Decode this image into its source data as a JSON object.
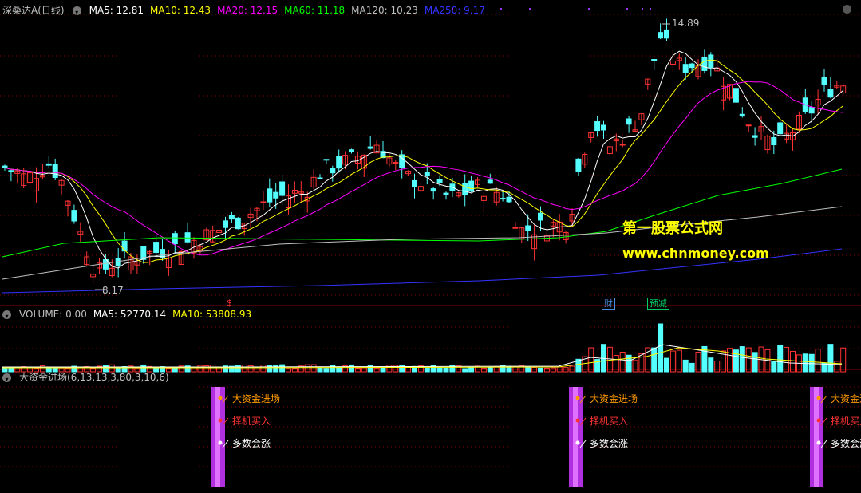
{
  "price_panel": {
    "stock_name": "深桑达A",
    "period": "(日线)",
    "ma_labels": [
      {
        "text": "MA5: 12.81",
        "color": "#ffffff"
      },
      {
        "text": "MA10: 12.43",
        "color": "#ffff00"
      },
      {
        "text": "MA20: 12.15",
        "color": "#ff00ff"
      },
      {
        "text": "MA60: 11.18",
        "color": "#00ff00"
      },
      {
        "text": "MA120: 10.23",
        "color": "#c0c0c0"
      },
      {
        "text": "MA250: 9.17",
        "color": "#3333ff"
      }
    ],
    "high_label": "14.89",
    "low_label": "8.17",
    "badges": [
      {
        "text": "$",
        "color": "#ff3333"
      },
      {
        "text": "财",
        "color": "#4a90e2"
      },
      {
        "text": "预减",
        "color": "#00cc66"
      }
    ],
    "icon": "gear-circle-icon"
  },
  "volume_panel": {
    "labels": [
      {
        "text": "VOLUME: 0.00",
        "color": "#c0c0c0"
      },
      {
        "text": "MA5: 52770.14",
        "color": "#ffffff"
      },
      {
        "text": "MA10: 53808.93",
        "color": "#ffff00"
      }
    ]
  },
  "indicator_panel": {
    "title": "大资金进场(6,13,13,3,80,3,10,6)",
    "signal_texts": [
      {
        "text": "大资金进场",
        "color": "#ff9900"
      },
      {
        "text": "择机买入",
        "color": "#ff3333"
      },
      {
        "text": "多数会涨",
        "color": "#ffffff"
      }
    ],
    "signal_bar_color": "#b030e0"
  },
  "watermark": {
    "line1": "第一股票公式网",
    "line2": "www.chnmoney.com"
  },
  "colors": {
    "up": "#ff3333",
    "down": "#54ffff",
    "grid": "#8b0000"
  }
}
